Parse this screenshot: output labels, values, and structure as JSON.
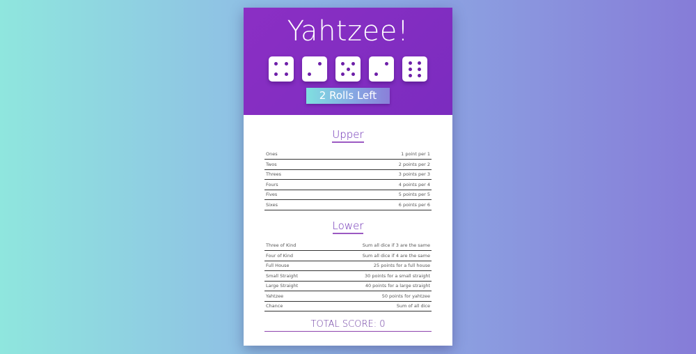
{
  "game": {
    "title": "Yahtzee!",
    "roll_button_label": "2 Rolls Left",
    "dice": [
      4,
      2,
      5,
      2,
      6
    ]
  },
  "upper": {
    "title": "Upper",
    "rows": [
      {
        "name": "Ones",
        "description": "1 point per 1"
      },
      {
        "name": "Twos",
        "description": "2 points per 2"
      },
      {
        "name": "Threes",
        "description": "3 points per 3"
      },
      {
        "name": "Fours",
        "description": "4 points per 4"
      },
      {
        "name": "Fives",
        "description": "5 points per 5"
      },
      {
        "name": "Sixes",
        "description": "6 points per 6"
      }
    ]
  },
  "lower": {
    "title": "Lower",
    "rows": [
      {
        "name": "Three of Kind",
        "description": "Sum all dice if 3 are the same"
      },
      {
        "name": "Four of Kind",
        "description": "Sum all dice if 4 are the same"
      },
      {
        "name": "Full House",
        "description": "25 points for a full house"
      },
      {
        "name": "Small Straight",
        "description": "30 points for a small straight"
      },
      {
        "name": "Large Straight",
        "description": "40 points for a large straight"
      },
      {
        "name": "Yahtzee",
        "description": "50 points for yahtzee"
      },
      {
        "name": "Chance",
        "description": "Sum of all dice"
      }
    ]
  },
  "total": {
    "label": "TOTAL SCORE: 0"
  },
  "colors": {
    "header_purple": "#8b2fc4",
    "pip_purple": "#6d1fa8",
    "bg_left": "#8fe6de",
    "bg_right": "#867cd8"
  }
}
